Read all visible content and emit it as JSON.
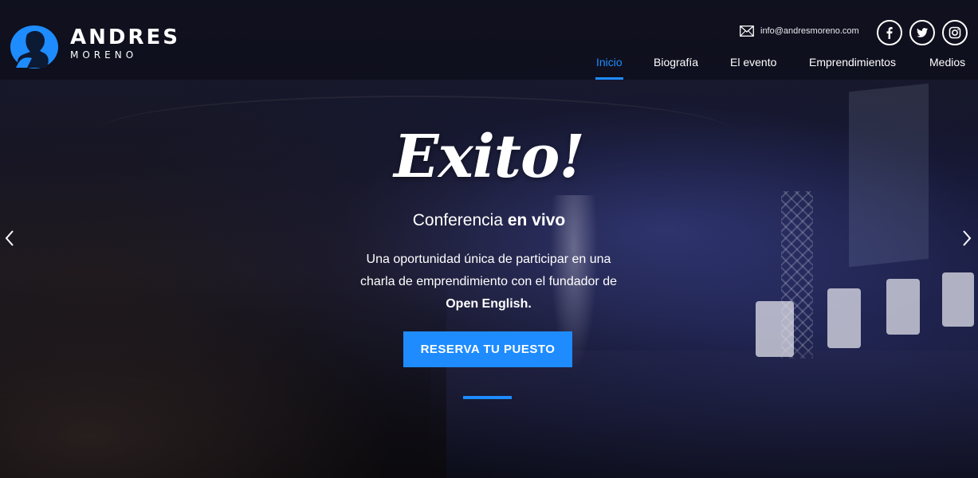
{
  "brand": {
    "name": "ANDRES",
    "sub": "MORENO",
    "accent": "#1e8cff"
  },
  "contact": {
    "email": "info@andresmoreno.com",
    "icon": "mail-icon"
  },
  "social": [
    {
      "name": "facebook",
      "icon": "facebook-icon"
    },
    {
      "name": "twitter",
      "icon": "twitter-icon"
    },
    {
      "name": "instagram",
      "icon": "instagram-icon"
    }
  ],
  "nav": {
    "items": [
      {
        "label": "Inicio",
        "active": true
      },
      {
        "label": "Biografía",
        "active": false
      },
      {
        "label": "El evento",
        "active": false
      },
      {
        "label": "Emprendimientos",
        "active": false
      },
      {
        "label": "Medios",
        "active": false
      }
    ]
  },
  "hero": {
    "title": "Exito!",
    "subtitle_prefix": "Conferencia ",
    "subtitle_bold": "en vivo",
    "desc_line1": "Una oportunidad única de participar en una",
    "desc_line2": "charla de emprendimiento con el fundador de",
    "desc_bold": "Open English.",
    "cta_label": "RESERVA TU PUESTO"
  },
  "slider": {
    "prev_icon": "chevron-left-icon",
    "next_icon": "chevron-right-icon"
  }
}
